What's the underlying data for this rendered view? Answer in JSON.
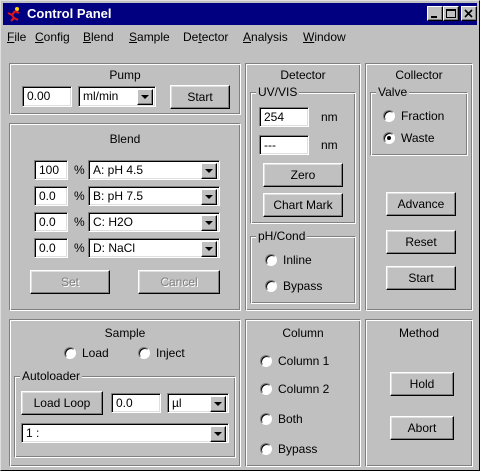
{
  "window": {
    "title": "Control Panel"
  },
  "menu": [
    {
      "label": "File",
      "key": "F",
      "rest": "ile"
    },
    {
      "label": "Config",
      "key": "C",
      "rest": "onfig"
    },
    {
      "label": "Blend",
      "key": "B",
      "rest": "lend"
    },
    {
      "label": "Sample",
      "key": "S",
      "rest": "ample"
    },
    {
      "label": "Detector",
      "key": "",
      "pre": "De",
      "u": "t",
      "rest": "ector"
    },
    {
      "label": "Analysis",
      "key": "A",
      "rest": "nalysis"
    },
    {
      "label": "Window",
      "key": "W",
      "rest": "indow"
    }
  ],
  "pump": {
    "title": "Pump",
    "flow_value": "0.00",
    "unit_selected": "ml/min",
    "start_label": "Start"
  },
  "blend": {
    "title": "Blend",
    "rows": [
      {
        "percent": "100",
        "pct_symbol": "%",
        "solvent": "A: pH 4.5"
      },
      {
        "percent": "0.0",
        "pct_symbol": "%",
        "solvent": "B: pH 7.5"
      },
      {
        "percent": "0.0",
        "pct_symbol": "%",
        "solvent": "C: H2O"
      },
      {
        "percent": "0.0",
        "pct_symbol": "%",
        "solvent": "D: NaCl"
      }
    ],
    "set_label": "Set",
    "cancel_label": "Cancel"
  },
  "detector": {
    "title": "Detector",
    "uvvis_label": "UV/VIS",
    "wavelength1": "254",
    "wavelength2": "---",
    "unit": "nm",
    "zero_label": "Zero",
    "chart_mark_label": "Chart Mark",
    "phcond_label": "pH/Cond",
    "inline_label": "Inline",
    "bypass_label": "Bypass",
    "phcond_selected": "none"
  },
  "collector": {
    "title": "Collector",
    "valve_label": "Valve",
    "fraction_label": "Fraction",
    "waste_label": "Waste",
    "valve_selected": "Waste",
    "advance_label": "Advance",
    "reset_label": "Reset",
    "start_label": "Start"
  },
  "sample": {
    "title": "Sample",
    "load_label": "Load",
    "inject_label": "Inject",
    "autoloader_label": "Autoloader",
    "load_loop_label": "Load Loop",
    "volume_value": "0.0",
    "volume_unit": "µl",
    "position_selected": "1 :"
  },
  "column": {
    "title": "Column",
    "options": [
      "Column 1",
      "Column 2",
      "Both",
      "Bypass"
    ],
    "selected": "none"
  },
  "method": {
    "title": "Method",
    "hold_label": "Hold",
    "abort_label": "Abort"
  },
  "icons": {
    "app": "dancing-figure-icon",
    "minimize": "minimize-icon",
    "maximize": "maximize-icon",
    "close": "close-icon",
    "dropdown": "chevron-down-icon"
  },
  "colors": {
    "titlebar": "#000080",
    "face": "#c0c0c0",
    "field": "#ffffff"
  }
}
